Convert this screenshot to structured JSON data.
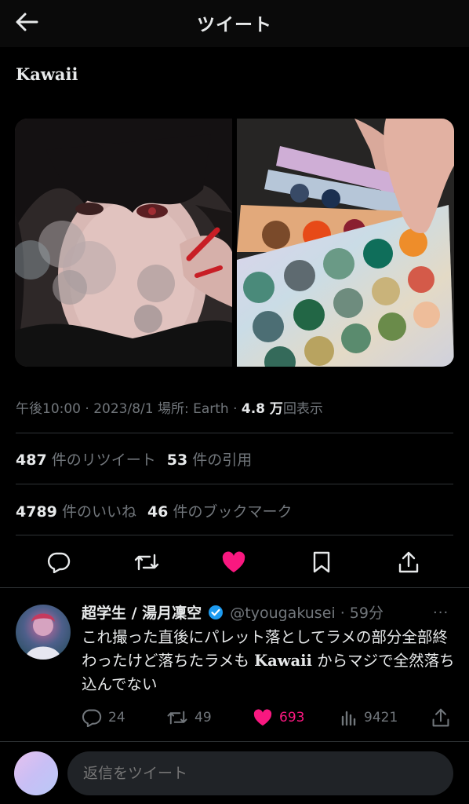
{
  "header": {
    "title": "ツイート"
  },
  "tweet": {
    "text": "Kawaii",
    "meta_prefix": "午後10:00 · 2023/8/1 場所: Earth · ",
    "views_count": "4.8 万",
    "views_suffix": "回表示",
    "retweets_count": "487",
    "retweets_label": "件のリツイート",
    "quotes_count": "53",
    "quotes_label": "件の引用",
    "likes_count": "4789",
    "likes_label": "件のいいね",
    "bookmarks_count": "46",
    "bookmarks_label": "件のブックマーク"
  },
  "reply": {
    "name": "超学生 / 湯月凜空",
    "handle": "@tyougakusei · 59分",
    "more": "···",
    "body_part1": "これ撮った直後にパレット落としてラメの部分全部終わったけど落ちたラメも ",
    "body_serif": "Kawaii",
    "body_part2": " からマジで全然落ち込んでない",
    "replies": "24",
    "retweets": "49",
    "likes": "693",
    "views": "9421"
  },
  "composer": {
    "placeholder": "返信をツイート"
  },
  "colors": {
    "like_pink": "#f91880",
    "verified_blue": "#1d9bf0",
    "muted": "#71767b"
  }
}
